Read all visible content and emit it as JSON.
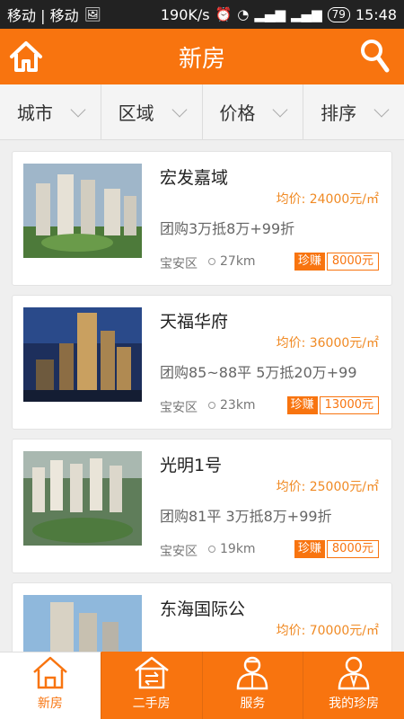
{
  "status_bar": {
    "carrier": "移动 | 移动",
    "speed": "190K/s",
    "battery": "79",
    "time": "15:48"
  },
  "header": {
    "title": "新房",
    "home_icon": "home-icon",
    "search_icon": "search-icon"
  },
  "filters": [
    {
      "label": "城市"
    },
    {
      "label": "区域"
    },
    {
      "label": "价格"
    },
    {
      "label": "排序"
    }
  ],
  "listings": [
    {
      "name": "宏发嘉域",
      "price": "均价: 24000元/㎡",
      "desc": "团购3万抵8万+99折",
      "area": "宝安区",
      "distance": "27km",
      "tag": "珍赚",
      "amount": "8000元"
    },
    {
      "name": "天福华府",
      "price": "均价: 36000元/㎡",
      "desc": "团购85~88平 5万抵20万+99",
      "area": "宝安区",
      "distance": "23km",
      "tag": "珍赚",
      "amount": "13000元"
    },
    {
      "name": "光明1号",
      "price": "均价: 25000元/㎡",
      "desc": "团购81平 3万抵8万+99折",
      "area": "宝安区",
      "distance": "19km",
      "tag": "珍赚",
      "amount": "8000元"
    },
    {
      "name": "东海国际公",
      "price": "均价: 70000元/㎡",
      "desc": "",
      "area": "",
      "distance": "",
      "tag": "",
      "amount": ""
    }
  ],
  "bottom_nav": [
    {
      "label": "新房",
      "icon": "home-icon",
      "active": true
    },
    {
      "label": "二手房",
      "icon": "house-swap-icon",
      "active": false
    },
    {
      "label": "服务",
      "icon": "agent-icon",
      "active": false
    },
    {
      "label": "我的珍房",
      "icon": "user-icon",
      "active": false
    }
  ],
  "colors": {
    "accent": "#f8740f",
    "price": "#f08a24",
    "background": "#efefef"
  }
}
